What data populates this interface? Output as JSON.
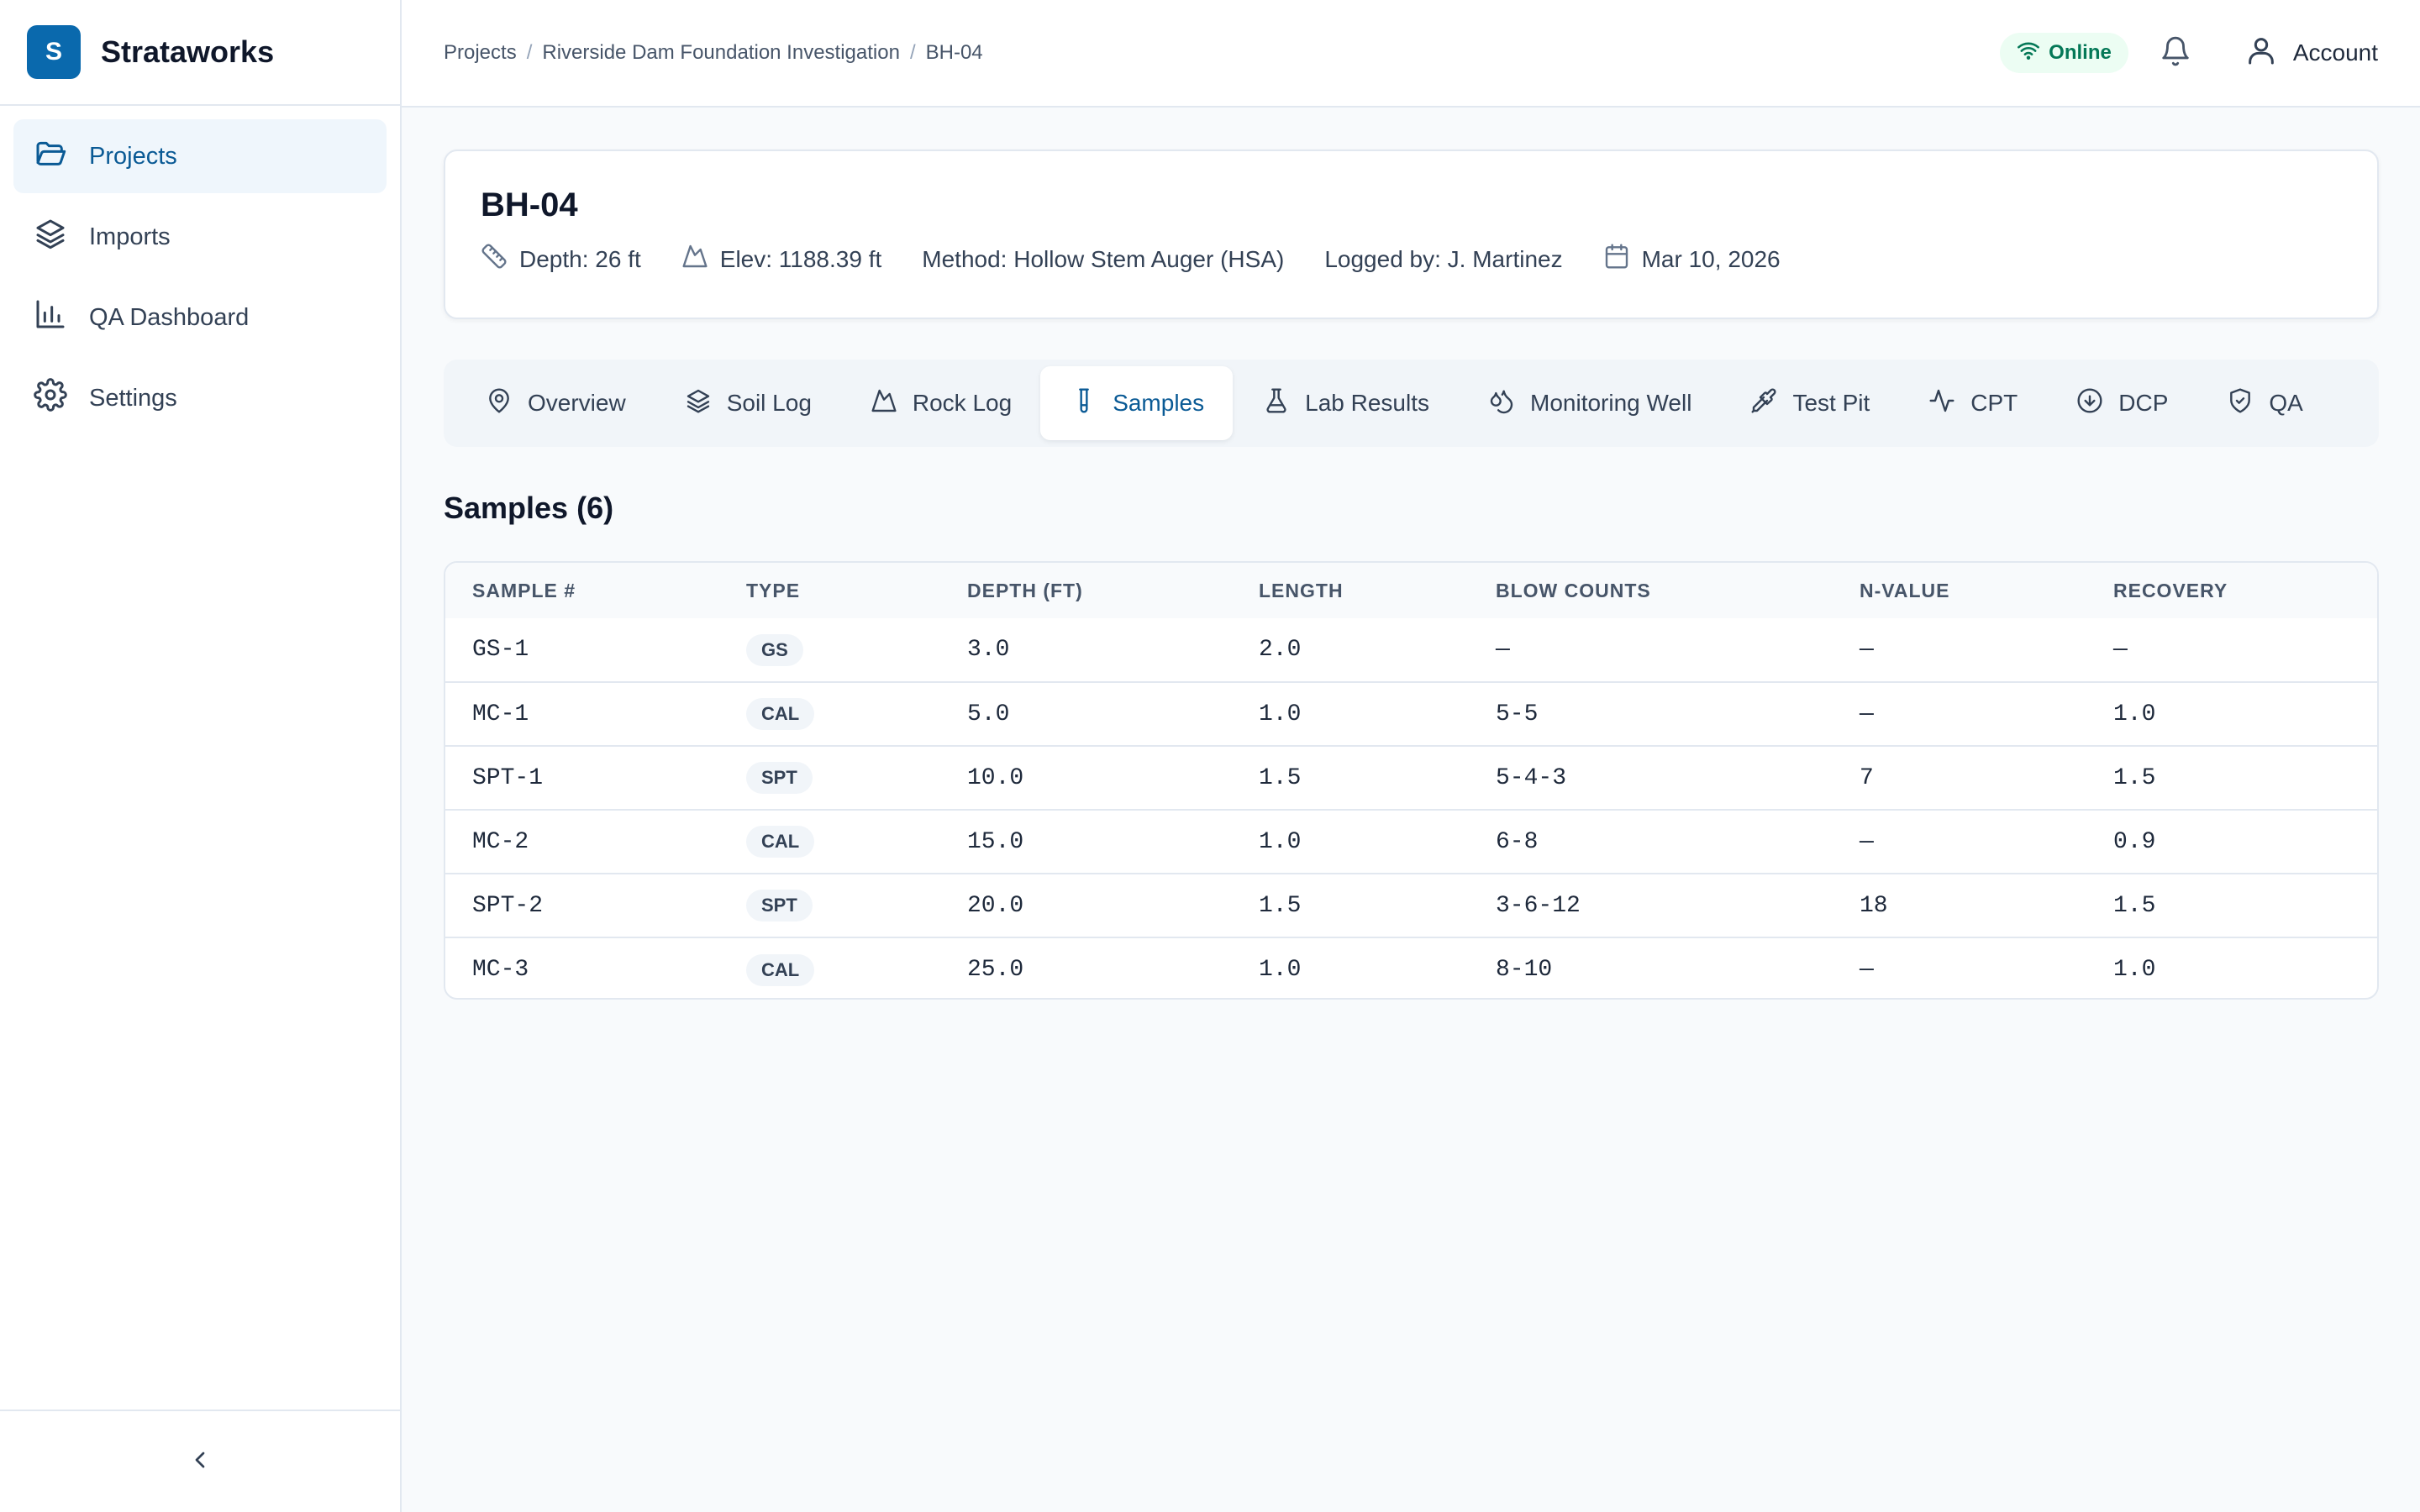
{
  "brand": {
    "initial": "S",
    "name": "Strataworks"
  },
  "sidebar": {
    "items": [
      {
        "label": "Projects",
        "icon": "folder-open-icon",
        "active": true
      },
      {
        "label": "Imports",
        "icon": "layers-icon",
        "active": false
      },
      {
        "label": "QA Dashboard",
        "icon": "bar-chart-icon",
        "active": false
      },
      {
        "label": "Settings",
        "icon": "gear-icon",
        "active": false
      }
    ],
    "collapse_icon": "chevron-left-icon"
  },
  "header": {
    "breadcrumb": [
      "Projects",
      "Riverside Dam Foundation Investigation",
      "BH-04"
    ],
    "breadcrumb_separator": "/",
    "status": "Online",
    "account_label": "Account"
  },
  "borehole": {
    "title": "BH-04",
    "depth": "Depth: 26 ft",
    "elevation": "Elev: 1188.39 ft",
    "method": "Method: Hollow Stem Auger (HSA)",
    "logged_by": "Logged by: J. Martinez",
    "date": "Mar 10, 2026"
  },
  "tabs": [
    {
      "label": "Overview",
      "icon": "map-pin-icon"
    },
    {
      "label": "Soil Log",
      "icon": "layers-icon"
    },
    {
      "label": "Rock Log",
      "icon": "mountain-icon"
    },
    {
      "label": "Samples",
      "icon": "test-tube-icon",
      "active": true
    },
    {
      "label": "Lab Results",
      "icon": "flask-icon"
    },
    {
      "label": "Monitoring Well",
      "icon": "droplets-icon"
    },
    {
      "label": "Test Pit",
      "icon": "shovel-icon"
    },
    {
      "label": "CPT",
      "icon": "activity-icon"
    },
    {
      "label": "DCP",
      "icon": "arrow-down-circle-icon"
    },
    {
      "label": "QA",
      "icon": "shield-check-icon"
    }
  ],
  "samples": {
    "title": "Samples (6)",
    "columns": [
      "SAMPLE #",
      "TYPE",
      "DEPTH (FT)",
      "LENGTH",
      "BLOW COUNTS",
      "N-VALUE",
      "RECOVERY"
    ],
    "rows": [
      [
        "GS-1",
        "GS",
        "3.0",
        "2.0",
        "—",
        "—",
        "—"
      ],
      [
        "MC-1",
        "CAL",
        "5.0",
        "1.0",
        "5-5",
        "—",
        "1.0"
      ],
      [
        "SPT-1",
        "SPT",
        "10.0",
        "1.5",
        "5-4-3",
        "7",
        "1.5"
      ],
      [
        "MC-2",
        "CAL",
        "15.0",
        "1.0",
        "6-8",
        "—",
        "0.9"
      ],
      [
        "SPT-2",
        "SPT",
        "20.0",
        "1.5",
        "3-6-12",
        "18",
        "1.5"
      ],
      [
        "MC-3",
        "CAL",
        "25.0",
        "1.0",
        "8-10",
        "—",
        "1.0"
      ]
    ]
  },
  "colors": {
    "accent": "#0a69ad",
    "online": "#047857",
    "active_bg": "#eff6fc"
  }
}
